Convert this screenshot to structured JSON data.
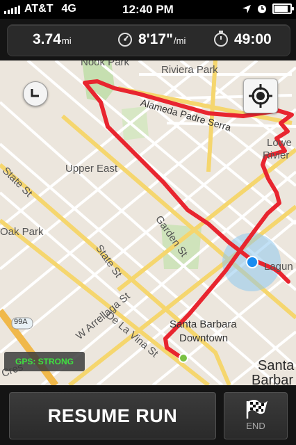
{
  "status_bar": {
    "carrier": "AT&T",
    "network": "4G",
    "time": "12:40 PM",
    "icons": [
      "location-arrow-icon",
      "alarm-clock-icon",
      "battery-icon"
    ]
  },
  "stats": {
    "distance_value": "3.74",
    "distance_unit": "mi",
    "pace_value": "8'17\"",
    "pace_unit": "/mi",
    "duration_value": "49:00",
    "pace_icon": "speedometer-icon",
    "duration_icon": "stopwatch-icon"
  },
  "map": {
    "labels": {
      "nook_park": "Nook Park",
      "riviera_park": "Riviera Park",
      "alameda_padre_serra": "Alameda Padre Serra",
      "lower_riviera_1": "Lowe",
      "lower_riviera_2": "Rivier",
      "upper_east": "Upper East",
      "state_st_top": "State St",
      "oak_park": "Oak Park",
      "garden_st": "Garden St",
      "state_st_mid": "State St",
      "laguna": "Lagun",
      "w_arrellaga_st": "W Arrellaga St",
      "de_la_vina_st": "De La Vina St",
      "sb_downtown_1": "Santa Barbara",
      "sb_downtown_2": "Downtown",
      "santa_1": "Santa",
      "santa_2": "Barbar",
      "highway": "99A",
      "bottom_left": "Cres"
    },
    "route_color": "#e8252f",
    "gps_status": "GPS: STRONG",
    "gps_color": "#3fe23f"
  },
  "actions": {
    "resume_label": "RESUME RUN",
    "end_label": "END"
  }
}
